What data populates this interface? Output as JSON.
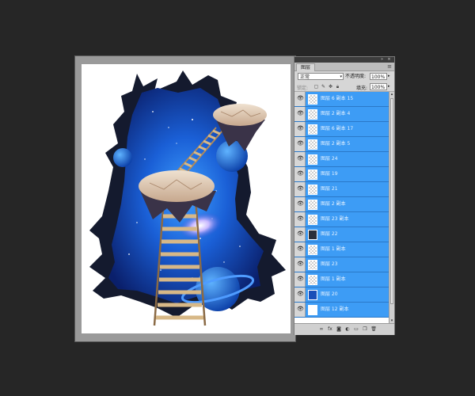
{
  "layers_panel": {
    "tab_label": "图层",
    "menu_icon": "panel-menu-icon",
    "blend_mode": "正常",
    "opacity_label": "不透明度:",
    "opacity_value": "100%",
    "lock_label": "锁定:",
    "fill_label": "填充:",
    "fill_value": "100%",
    "layers": [
      {
        "name": "图层 6 副本 15",
        "thumb": "transparent"
      },
      {
        "name": "图层 2 副本 4",
        "thumb": "transparent"
      },
      {
        "name": "图层 6 副本 17",
        "thumb": "transparent"
      },
      {
        "name": "图层 2 副本 5",
        "thumb": "transparent"
      },
      {
        "name": "图层 24",
        "thumb": "transparent"
      },
      {
        "name": "图层 19",
        "thumb": "transparent"
      },
      {
        "name": "图层 21",
        "thumb": "transparent"
      },
      {
        "name": "图层 2 副本",
        "thumb": "transparent"
      },
      {
        "name": "图层 23 副本",
        "thumb": "transparent"
      },
      {
        "name": "图层 22",
        "thumb": "dark"
      },
      {
        "name": "图层 1 副本",
        "thumb": "transparent"
      },
      {
        "name": "图层 23",
        "thumb": "transparent"
      },
      {
        "name": "图层 1 副本",
        "thumb": "transparent"
      },
      {
        "name": "图层 20",
        "thumb": "blue"
      },
      {
        "name": "图层 12 副本",
        "thumb": "white"
      }
    ],
    "bottom_icons": [
      "link-layers-icon",
      "fx-icon",
      "add-mask-icon",
      "adjustment-layer-icon",
      "group-folder-icon",
      "new-layer-icon",
      "trash-icon"
    ]
  },
  "colors": {
    "app_background": "#262626",
    "layer_selected": "#3d9cf5",
    "space_deep": "#0a1f6b",
    "space_light": "#3fa0ff"
  }
}
